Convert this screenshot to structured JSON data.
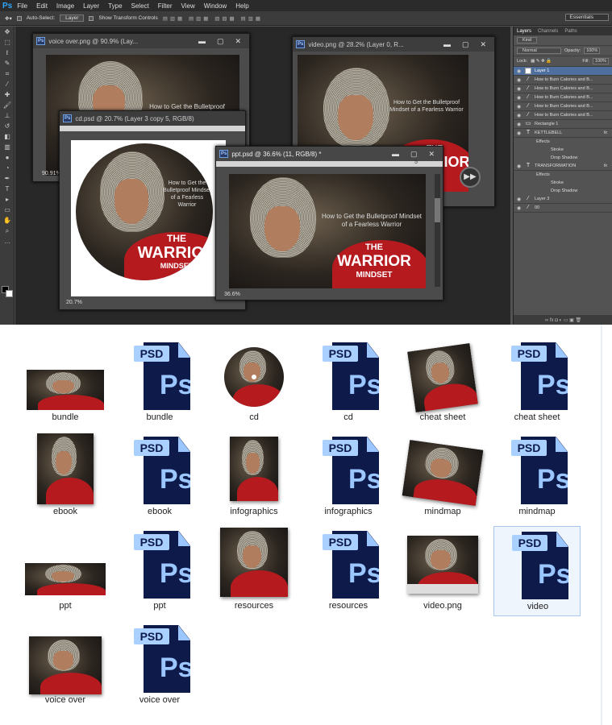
{
  "app": {
    "logo": "Ps",
    "menu": [
      "File",
      "Edit",
      "Image",
      "Layer",
      "Type",
      "Select",
      "Filter",
      "View",
      "Window",
      "Help"
    ],
    "options": {
      "auto_select": "Auto-Select:",
      "auto_select_value": "Layer",
      "show_transform": "Show Transform Controls"
    },
    "workspace": "Essentials"
  },
  "windows": {
    "voice": {
      "title": "voice over.png @ 90.9% (Lay...",
      "zoom": "90.91%"
    },
    "video": {
      "title": "video.png @ 28.2% (Layer 0, R..."
    },
    "cd": {
      "title": "cd.psd @ 20.7% (Layer 3 copy 5, RGB/8)",
      "zoom": "20.7%"
    },
    "ppt": {
      "title": "ppt.psd @ 36.6% (11, RGB/8) *",
      "zoom": "36.6%",
      "ruler_mark": "5"
    }
  },
  "art": {
    "tagline": "How to Get the Bulletproof Mindset of a Fearless Warrior",
    "the": "THE",
    "warrior": "WARRIOR",
    "mindset": "MINDSET"
  },
  "layers_panel": {
    "tabs": [
      "Layers",
      "Channels",
      "Paths"
    ],
    "kind": "Kind",
    "blend": "Normal",
    "opacity_label": "Opacity:",
    "opacity": "100%",
    "lock_label": "Lock:",
    "fill_label": "Fill:",
    "fill": "100%",
    "rows": [
      {
        "name": "Layer 1",
        "type": "thumb",
        "selected": true
      },
      {
        "name": "How to Burn Calories and B...",
        "type": "brush"
      },
      {
        "name": "How to Burn Calories and B...",
        "type": "brush"
      },
      {
        "name": "How to Burn Calories and B...",
        "type": "brush"
      },
      {
        "name": "How to Burn Calories and B...",
        "type": "brush"
      },
      {
        "name": "How to Burn Calories and B...",
        "type": "brush"
      },
      {
        "name": "Rectangle 1",
        "type": "shape"
      },
      {
        "name": "KETTLEBELL",
        "type": "text",
        "fx": true
      },
      {
        "name": "Effects",
        "type": "sub"
      },
      {
        "name": "Stroke",
        "type": "sub2"
      },
      {
        "name": "Drop Shadow",
        "type": "sub2"
      },
      {
        "name": "TRANSFORMATION",
        "type": "text",
        "fx": true
      },
      {
        "name": "Effects",
        "type": "sub"
      },
      {
        "name": "Stroke",
        "type": "sub2"
      },
      {
        "name": "Drop Shadow",
        "type": "sub2"
      },
      {
        "name": "Layer 3",
        "type": "brush"
      },
      {
        "name": "00",
        "type": "brush"
      }
    ]
  },
  "explorer": {
    "items": [
      {
        "label": "bundle",
        "kind": "bundle"
      },
      {
        "label": "bundle",
        "kind": "psd"
      },
      {
        "label": "cd",
        "kind": "cd"
      },
      {
        "label": "cd",
        "kind": "psd"
      },
      {
        "label": "cheat sheet",
        "kind": "cheat"
      },
      {
        "label": "cheat sheet",
        "kind": "psd"
      },
      {
        "label": "ebook",
        "kind": "ebook"
      },
      {
        "label": "ebook",
        "kind": "psd"
      },
      {
        "label": "infographics",
        "kind": "infographic"
      },
      {
        "label": "infographics",
        "kind": "psd"
      },
      {
        "label": "mindmap",
        "kind": "mindmap"
      },
      {
        "label": "mindmap",
        "kind": "psd"
      },
      {
        "label": "ppt",
        "kind": "ppt"
      },
      {
        "label": "ppt",
        "kind": "psd"
      },
      {
        "label": "resources",
        "kind": "resources"
      },
      {
        "label": "resources",
        "kind": "psd"
      },
      {
        "label": "video.png",
        "kind": "video"
      },
      {
        "label": "video",
        "kind": "psd",
        "selected": true
      },
      {
        "label": "voice over",
        "kind": "voice"
      },
      {
        "label": "voice over",
        "kind": "psd"
      }
    ],
    "psd_tag": "PSD",
    "ps_glyph": "Ps"
  }
}
